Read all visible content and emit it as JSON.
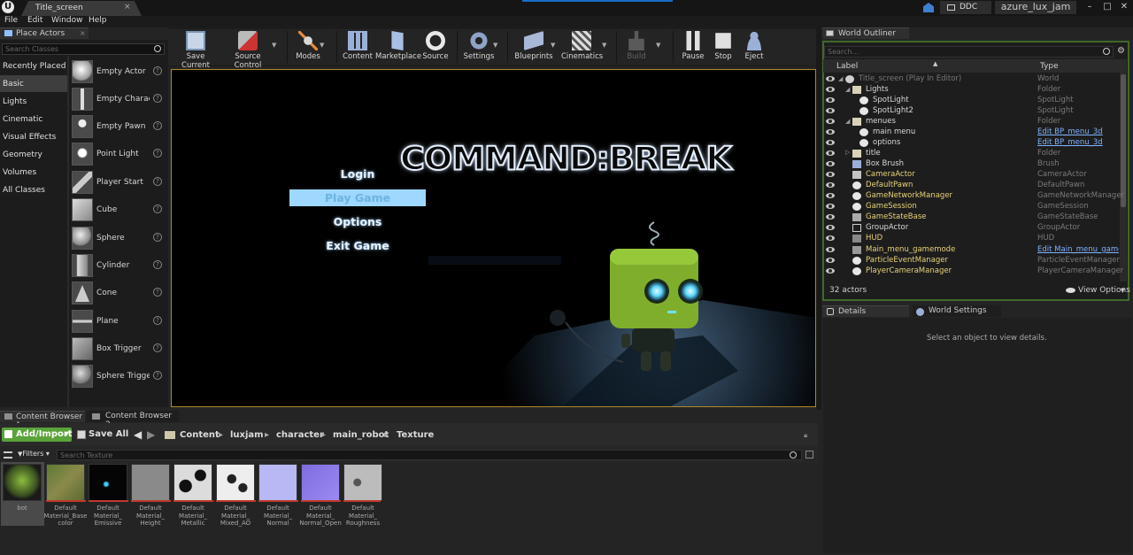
{
  "title_bar": {
    "logo": "U",
    "document_tab": "Title_screen",
    "ddc_label": "DDC",
    "project_name": "azure_lux_jam"
  },
  "menu": [
    "File",
    "Edit",
    "Window",
    "Help"
  ],
  "place_actors": {
    "title": "Place Actors",
    "search_placeholder": "Search Classes",
    "categories": [
      "Recently Placed",
      "Basic",
      "Lights",
      "Cinematic",
      "Visual Effects",
      "Geometry",
      "Volumes",
      "All Classes"
    ],
    "selected_category": "Basic",
    "items": [
      "Empty Actor",
      "Empty Character",
      "Empty Pawn",
      "Point Light",
      "Player Start",
      "Cube",
      "Sphere",
      "Cylinder",
      "Cone",
      "Plane",
      "Box Trigger",
      "Sphere Trigger"
    ]
  },
  "toolbar": {
    "buttons": [
      "Save Current",
      "Source Control",
      "Modes",
      "Content",
      "Marketplace",
      "Source",
      "Settings",
      "Blueprints",
      "Cinematics",
      "Build",
      "Pause",
      "Stop",
      "Eject"
    ]
  },
  "viewport": {
    "game_title": "COMMAND:BREAK",
    "menu_items": [
      "Login",
      "Play Game",
      "Options",
      "Exit Game"
    ],
    "selected_item": "Play Game"
  },
  "world_outliner": {
    "title": "World Outliner",
    "search_placeholder": "Search...",
    "col_label": "Label",
    "col_type": "Type",
    "rows": [
      {
        "label": "Title_screen (Play In Editor)",
        "type": "World"
      },
      {
        "label": "Lights",
        "type": "Folder"
      },
      {
        "label": "SpotLight",
        "type": "SpotLight"
      },
      {
        "label": "SpotLight2",
        "type": "SpotLight"
      },
      {
        "label": "menues",
        "type": "Folder"
      },
      {
        "label": "main menu",
        "type": "Edit BP_menu_3d"
      },
      {
        "label": "options",
        "type": "Edit BP_menu_3d"
      },
      {
        "label": "title",
        "type": "Folder"
      },
      {
        "label": "Box Brush",
        "type": "Brush"
      },
      {
        "label": "CameraActor",
        "type": "CameraActor"
      },
      {
        "label": "DefaultPawn",
        "type": "DefaultPawn"
      },
      {
        "label": "GameNetworkManager",
        "type": "GameNetworkManager"
      },
      {
        "label": "GameSession",
        "type": "GameSession"
      },
      {
        "label": "GameStateBase",
        "type": "GameStateBase"
      },
      {
        "label": "GroupActor",
        "type": "GroupActor"
      },
      {
        "label": "HUD",
        "type": "HUD"
      },
      {
        "label": "Main_menu_gamemode",
        "type": "Edit Main_menu_gamemode"
      },
      {
        "label": "ParticleEventManager",
        "type": "ParticleEventManager"
      },
      {
        "label": "PlayerCameraManager",
        "type": "PlayerCameraManager"
      }
    ],
    "actor_count": "32 actors",
    "view_options": "View Options"
  },
  "details": {
    "tab_details": "Details",
    "tab_world_settings": "World Settings",
    "empty_message": "Select an object to view details."
  },
  "content_browser": {
    "tab1": "Content Browser 1",
    "tab2": "Content Browser 2",
    "add_import": "Add/Import",
    "save_all": "Save All",
    "path": [
      "Content",
      "luxjam",
      "character",
      "main_robot",
      "Texture"
    ],
    "filters": "Filters",
    "search_placeholder": "Search Texture",
    "assets": [
      {
        "name": "bot",
        "color": "#5f7a3c"
      },
      {
        "name": "Default Material_Base color",
        "color": "#6d7a44"
      },
      {
        "name": "Default Material_ Emissive",
        "color": "#050505"
      },
      {
        "name": "Default Material_ Height",
        "color": "#8a8a8a"
      },
      {
        "name": "Default Material_ Metallic",
        "color": "#dcdcdc"
      },
      {
        "name": "Default Material_ Mixed_AO",
        "color": "#eeeeee"
      },
      {
        "name": "Default Material_ Normal",
        "color": "#b8b8f4"
      },
      {
        "name": "Default Material_ Normal_Open",
        "color": "#8470e0"
      },
      {
        "name": "Default Material_ Roughness",
        "color": "#bcbcbc"
      }
    ]
  }
}
